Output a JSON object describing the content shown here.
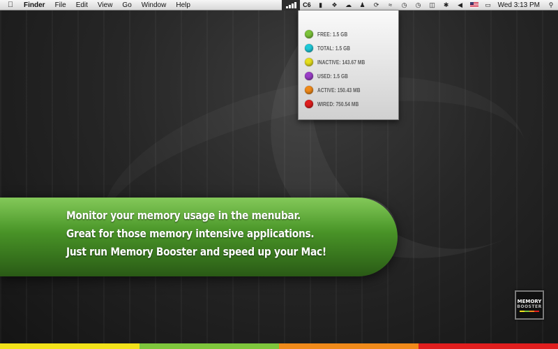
{
  "menubar": {
    "apple_icon": "apple-logo-icon",
    "app_name": "Finder",
    "menus": [
      "File",
      "Edit",
      "View",
      "Go",
      "Window",
      "Help"
    ],
    "status_items": {
      "memory_text": "C6",
      "clock": "Wed 3:13 PM"
    }
  },
  "memory_panel": {
    "rows": [
      {
        "label": "FREE: 1.5 GB",
        "color": "#7cc43a"
      },
      {
        "label": "TOTAL: 1.5 GB",
        "color": "#1fc9d8"
      },
      {
        "label": "INACTIVE: 143.67 MB",
        "color": "#e6df1f"
      },
      {
        "label": "USED: 1.5 GB",
        "color": "#9b3fc8"
      },
      {
        "label": "ACTIVE: 150.43 MB",
        "color": "#f08a1a"
      },
      {
        "label": "WIRED: 750.54 MB",
        "color": "#e01e1e"
      }
    ]
  },
  "banner": {
    "line1": "Monitor your memory usage in the menubar.",
    "line2": "Great for those memory intensive applications.",
    "line3": "Just run Memory Booster and speed up your Mac!"
  },
  "logo": {
    "line1": "MEMORY",
    "line2": "BOOSTER"
  },
  "colors": {
    "bottom_bar": [
      "#f2e21a",
      "#7ec63c",
      "#f08a1a",
      "#e01e1e"
    ]
  }
}
